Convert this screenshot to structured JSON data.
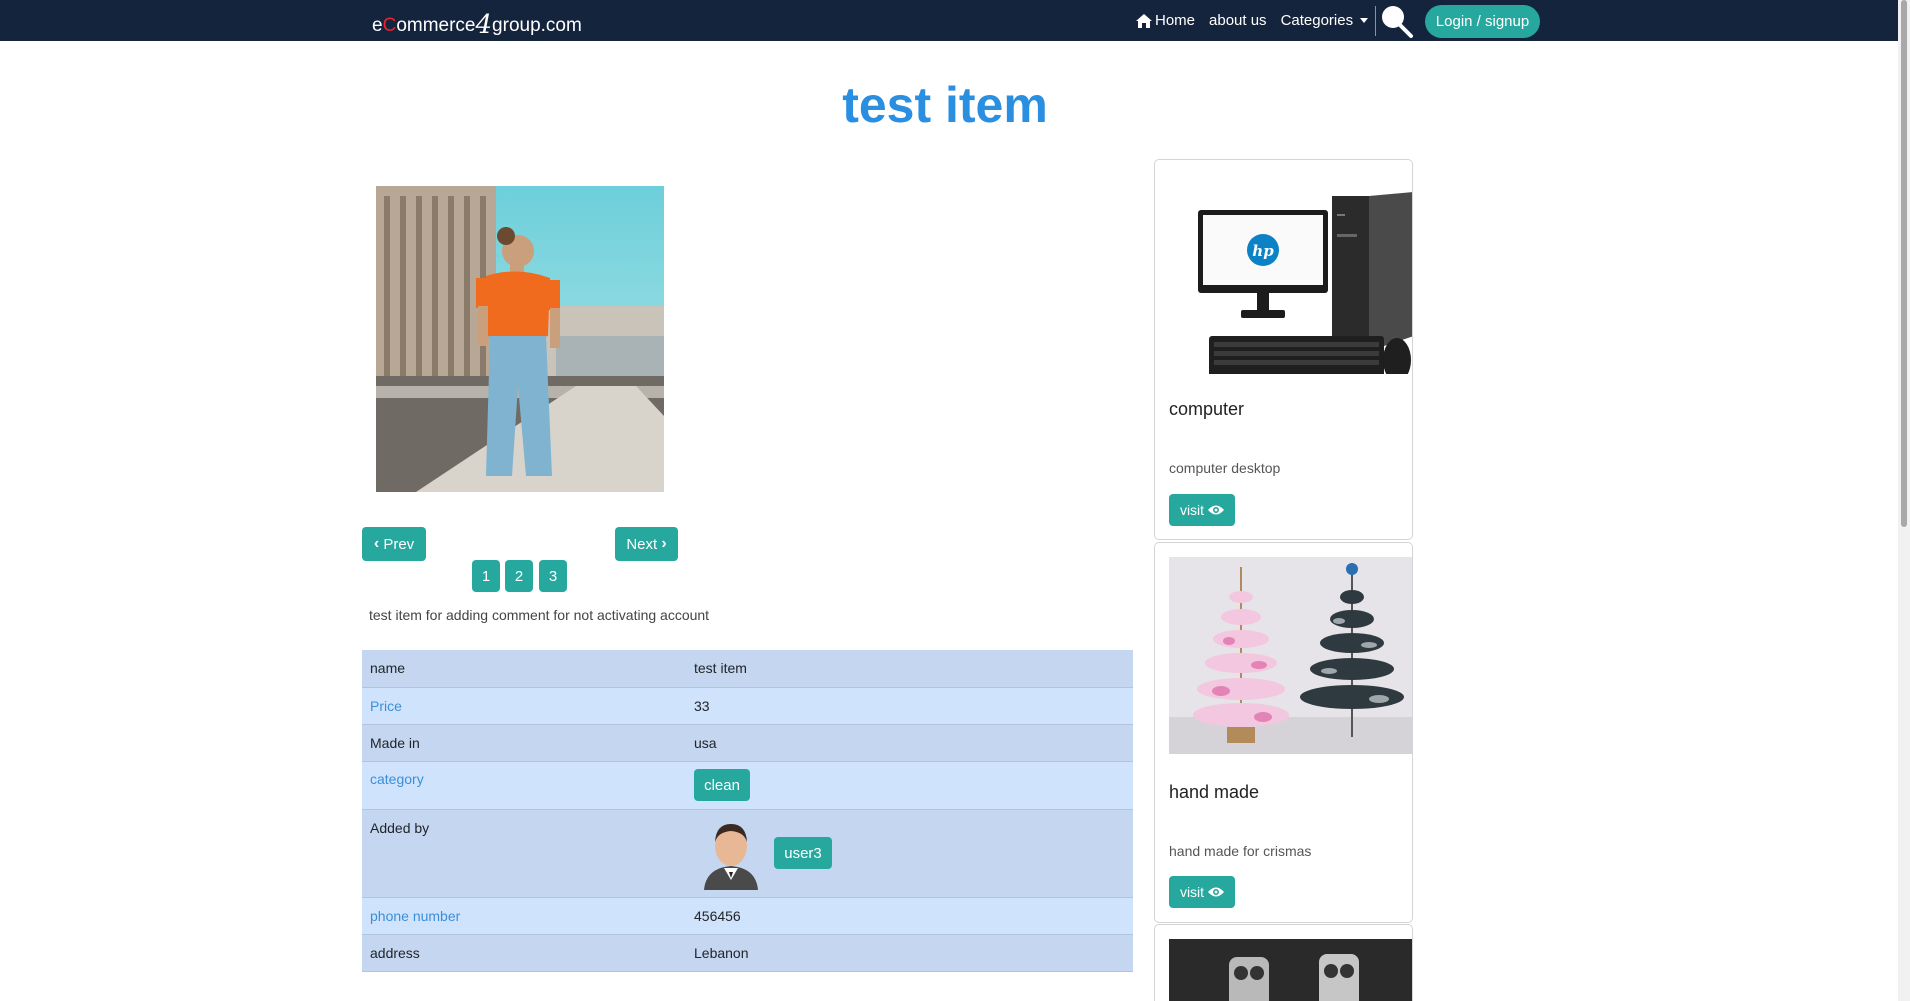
{
  "navbar": {
    "brand_prefix": "e",
    "brand_c": "C",
    "brand_mid": "ommerce",
    "brand_four": "4",
    "brand_suffix": "group.com",
    "home": "Home",
    "about": "about us",
    "categories": "Categories",
    "login": "Login / signup"
  },
  "page": {
    "title": "test item"
  },
  "gallery": {
    "prev": "Prev",
    "next": "Next",
    "pages": [
      "1",
      "2",
      "3"
    ]
  },
  "description": "test item for adding comment for not activating account",
  "details": {
    "rows": [
      {
        "key": "name",
        "value": "test item"
      },
      {
        "key": "Price",
        "value": "33"
      },
      {
        "key": "Made in",
        "value": "usa"
      },
      {
        "key": "category",
        "value": "clean"
      },
      {
        "key": "Added by",
        "value": "user3"
      },
      {
        "key": "phone number",
        "value": "456456"
      },
      {
        "key": "address",
        "value": "Lebanon"
      }
    ]
  },
  "cards": [
    {
      "title": "computer",
      "text": "computer desktop",
      "button": "visit"
    },
    {
      "title": "hand made",
      "text": "hand made for crismas",
      "button": "visit"
    }
  ],
  "colors": {
    "navbar": "#14243d",
    "accent": "#27a89e",
    "title": "#2a8fe0",
    "row_odd": "#c4d6f0",
    "row_even": "#d0e3fd",
    "brand_c": "#e8232f"
  },
  "icons": {
    "home": "home-icon",
    "search": "search-icon",
    "visit": "eye-icon",
    "prev": "chevron-left-icon",
    "next": "chevron-right-icon",
    "categories": "caret-down-icon"
  }
}
